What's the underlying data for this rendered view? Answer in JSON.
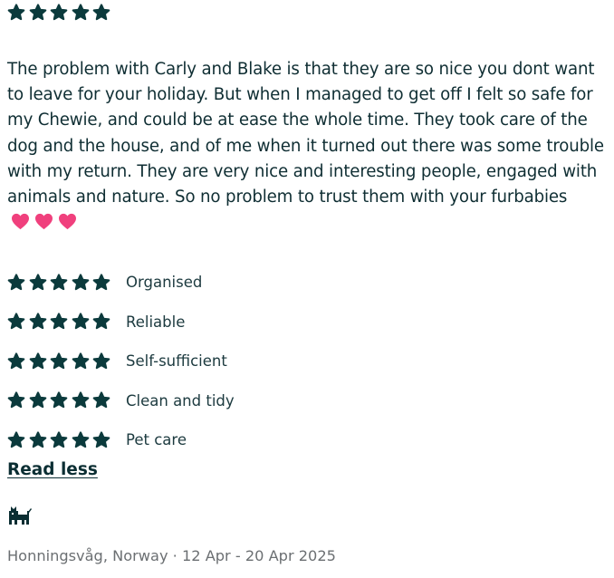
{
  "review": {
    "overall_rating": 5,
    "text": "The problem with Carly and Blake is that they are so nice you dont want to leave for your holiday. But when I managed to get off I felt so safe for my Chewie, and could be at ease the whole time. They took care of the dog and the house, and of me when it turned out there was some trouble with my return. They are very nice and interesting people, engaged with animals and nature. So no problem to trust them with your furbabies",
    "hearts": 3,
    "categories": [
      {
        "label": "Organised",
        "rating": 5
      },
      {
        "label": "Reliable",
        "rating": 5
      },
      {
        "label": "Self-sufficient",
        "rating": 5
      },
      {
        "label": "Clean and tidy",
        "rating": 5
      },
      {
        "label": "Pet care",
        "rating": 5
      }
    ],
    "read_less_label": "Read less",
    "pet_icon": "dog-icon",
    "meta": "Honningsvåg, Norway · 12 Apr - 20 Apr 2025"
  },
  "colors": {
    "star": "#0b3a3c",
    "text": "#0f2e33",
    "heart": "#f0407d",
    "meta": "#6b6f72"
  }
}
